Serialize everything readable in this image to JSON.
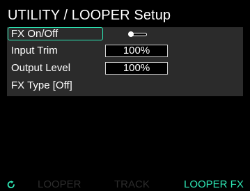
{
  "header": {
    "title": "UTILITY / LOOPER Setup"
  },
  "settings": [
    {
      "label": "FX On/Off",
      "type": "toggle",
      "state": "on",
      "selected": true
    },
    {
      "label": "Input Trim",
      "type": "value",
      "value": "100%"
    },
    {
      "label": "Output Level",
      "type": "value",
      "value": "100%"
    },
    {
      "label": "FX Type [Off]",
      "type": "text"
    }
  ],
  "tabs": [
    {
      "label": "LOOPER"
    },
    {
      "label": "TRACK"
    },
    {
      "label": "LOOPER FX",
      "active": true
    }
  ],
  "icons": {
    "refresh": "refresh-icon"
  },
  "colors": {
    "accent": "#2ee6b4",
    "panel": "#2b2b2b",
    "background": "#000000",
    "inactive_tab": "#2c2c2c"
  }
}
